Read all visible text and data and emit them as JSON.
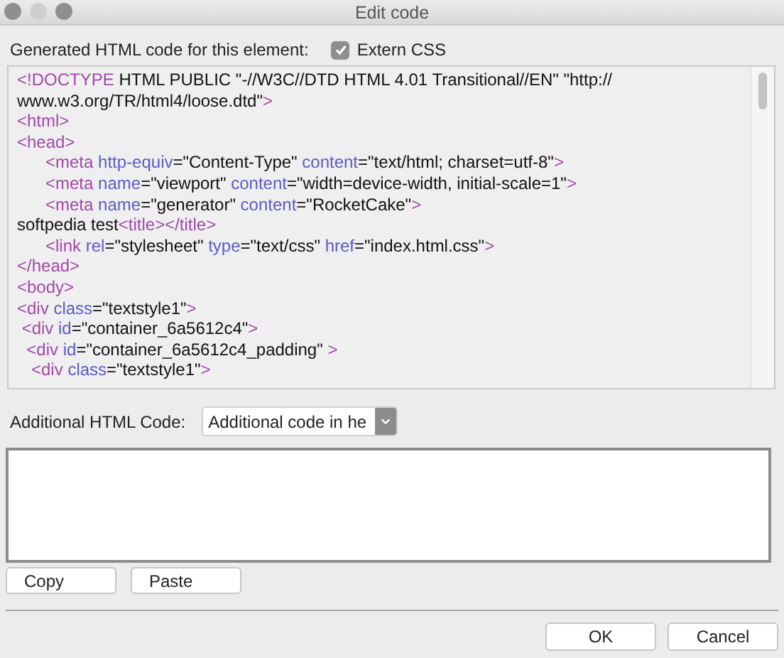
{
  "window": {
    "title": "Edit code"
  },
  "generated_label": "Generated HTML code for this element:",
  "extern_css": {
    "label": "Extern CSS",
    "checked": true
  },
  "code_lines": [
    [
      {
        "kind": "tag",
        "text": "<!DOCTYPE"
      },
      {
        "kind": "text",
        "text": " HTML PUBLIC \"-//W3C//DTD HTML 4.01 Transitional//EN\" \"http://"
      }
    ],
    [
      {
        "kind": "text",
        "text": "www.w3.org/TR/html4/loose.dtd\""
      },
      {
        "kind": "tag",
        "text": ">"
      }
    ],
    [
      {
        "kind": "tag",
        "text": "<html>"
      }
    ],
    [
      {
        "kind": "tag",
        "text": "<head>"
      }
    ],
    [
      {
        "kind": "tag",
        "text": "      <meta "
      },
      {
        "kind": "attr",
        "text": "http-equiv"
      },
      {
        "kind": "text",
        "text": "=\"Content-Type\" "
      },
      {
        "kind": "attr",
        "text": "content"
      },
      {
        "kind": "text",
        "text": "=\"text/html; charset=utf-8\""
      },
      {
        "kind": "tag",
        "text": ">"
      }
    ],
    [
      {
        "kind": "tag",
        "text": "      <meta "
      },
      {
        "kind": "attr",
        "text": "name"
      },
      {
        "kind": "text",
        "text": "=\"viewport\" "
      },
      {
        "kind": "attr",
        "text": "content"
      },
      {
        "kind": "text",
        "text": "=\"width=device-width, initial-scale=1\""
      },
      {
        "kind": "tag",
        "text": ">"
      }
    ],
    [
      {
        "kind": "tag",
        "text": "      <meta "
      },
      {
        "kind": "attr",
        "text": "name"
      },
      {
        "kind": "text",
        "text": "=\"generator\" "
      },
      {
        "kind": "attr",
        "text": "content"
      },
      {
        "kind": "text",
        "text": "=\"RocketCake\""
      },
      {
        "kind": "tag",
        "text": ">"
      }
    ],
    [
      {
        "kind": "text",
        "text": "softpedia test"
      },
      {
        "kind": "tag",
        "text": "<title></title>"
      }
    ],
    [
      {
        "kind": "tag",
        "text": "      <link "
      },
      {
        "kind": "attr",
        "text": "rel"
      },
      {
        "kind": "text",
        "text": "=\"stylesheet\" "
      },
      {
        "kind": "attr",
        "text": "type"
      },
      {
        "kind": "text",
        "text": "=\"text/css\" "
      },
      {
        "kind": "attr",
        "text": "href"
      },
      {
        "kind": "text",
        "text": "=\"index.html.css\""
      },
      {
        "kind": "tag",
        "text": ">"
      }
    ],
    [
      {
        "kind": "tag",
        "text": "</head>"
      }
    ],
    [
      {
        "kind": "tag",
        "text": "<body>"
      }
    ],
    [
      {
        "kind": "tag",
        "text": "<div "
      },
      {
        "kind": "attr",
        "text": "class"
      },
      {
        "kind": "text",
        "text": "=\"textstyle1\""
      },
      {
        "kind": "tag",
        "text": ">"
      }
    ],
    [
      {
        "kind": "tag",
        "text": " <div "
      },
      {
        "kind": "attr",
        "text": "id"
      },
      {
        "kind": "text",
        "text": "=\"container_6a5612c4\""
      },
      {
        "kind": "tag",
        "text": ">"
      }
    ],
    [
      {
        "kind": "tag",
        "text": "  <div "
      },
      {
        "kind": "attr",
        "text": "id"
      },
      {
        "kind": "text",
        "text": "=\"container_6a5612c4_padding\" "
      },
      {
        "kind": "tag",
        "text": ">"
      }
    ],
    [
      {
        "kind": "tag",
        "text": "   <div "
      },
      {
        "kind": "attr",
        "text": "class"
      },
      {
        "kind": "text",
        "text": "=\"textstyle1\""
      },
      {
        "kind": "tag",
        "text": ">"
      }
    ]
  ],
  "additional_label": "Additional HTML Code:",
  "additional_select": {
    "value": "Additional code in he"
  },
  "buttons": [
    {
      "label": "Copy"
    },
    {
      "label": "Paste"
    }
  ],
  "dialog_buttons": [
    {
      "label": "OK"
    },
    {
      "label": "Cancel"
    }
  ]
}
